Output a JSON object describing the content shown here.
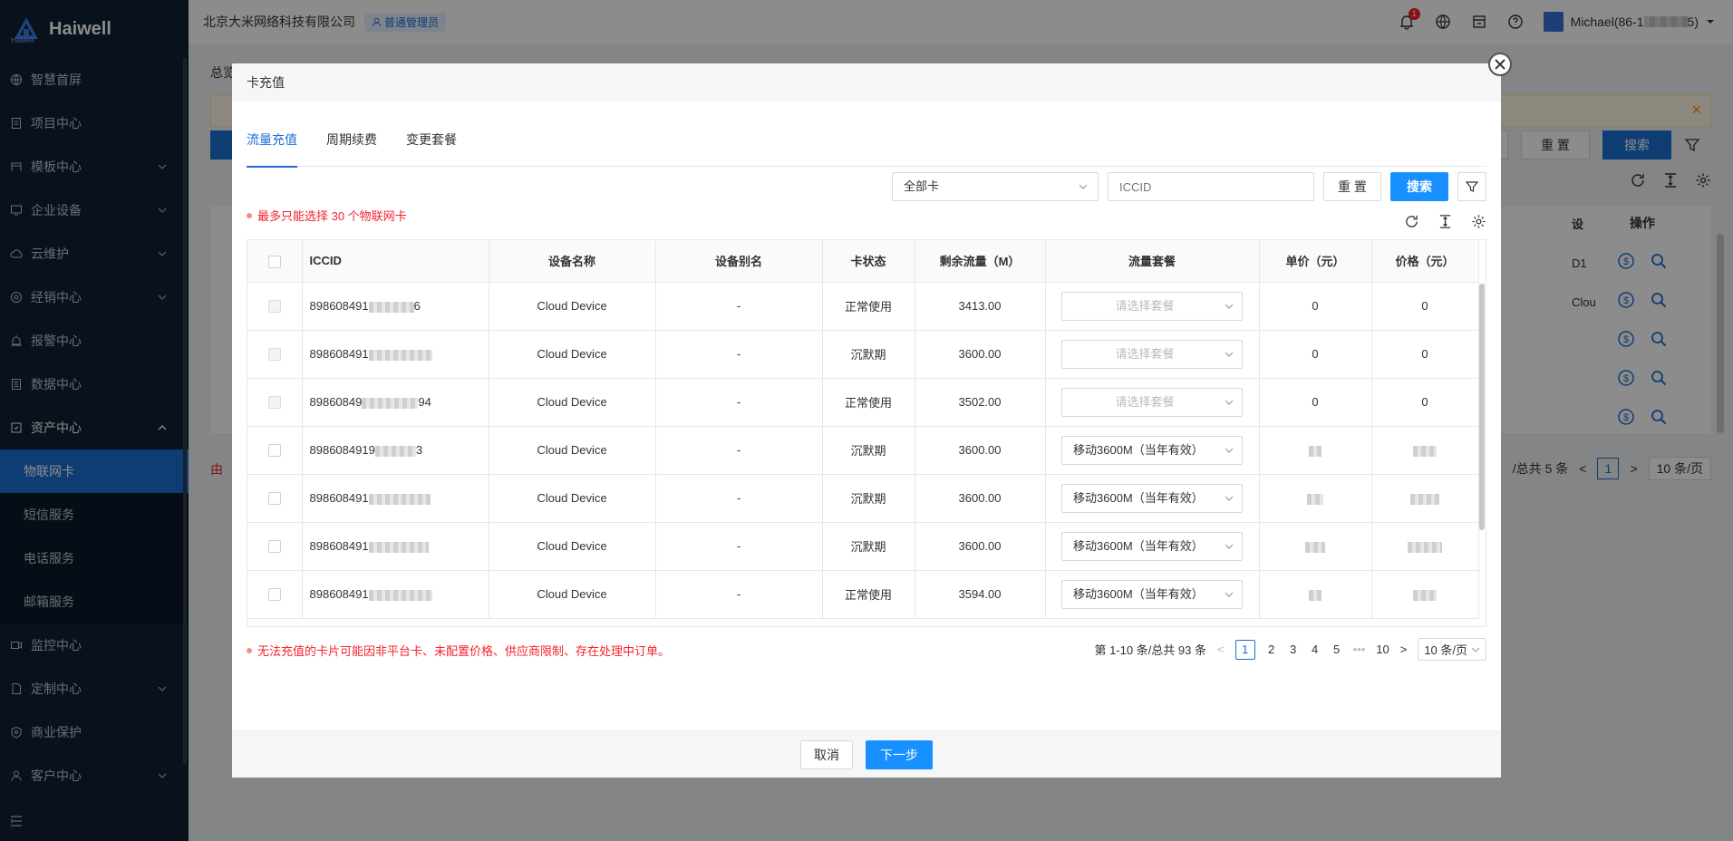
{
  "brand": {
    "name": "Haiwell",
    "sub": "Haiwell"
  },
  "header": {
    "company": "北京大米网络科技有限公司",
    "role": "普通管理员",
    "notif_count": "1",
    "user_name_prefix": "Michael(86-1",
    "user_name_suffix": "5)"
  },
  "sidebar": {
    "items": [
      {
        "label": "智慧首屏",
        "icon": "globe-icon"
      },
      {
        "label": "项目中心",
        "icon": "doc-icon"
      },
      {
        "label": "模板中心",
        "icon": "template-icon"
      },
      {
        "label": "企业设备",
        "icon": "monitor-icon"
      },
      {
        "label": "云维护",
        "icon": "cloud-icon"
      },
      {
        "label": "经销中心",
        "icon": "dealer-icon"
      },
      {
        "label": "报警中心",
        "icon": "alarm-icon"
      },
      {
        "label": "数据中心",
        "icon": "data-icon"
      },
      {
        "label": "资产中心",
        "icon": "asset-icon"
      }
    ],
    "sub_items": [
      "物联网卡",
      "短信服务",
      "电话服务",
      "邮箱服务"
    ],
    "items_after": [
      {
        "label": "监控中心",
        "icon": "camera-icon"
      },
      {
        "label": "定制中心",
        "icon": "custom-icon"
      },
      {
        "label": "商业保护",
        "icon": "shield-icon"
      },
      {
        "label": "客户中心",
        "icon": "user-icon"
      }
    ]
  },
  "background": {
    "crumb": "总览",
    "reset": "重 置",
    "search": "搜索",
    "ops_header": "操作",
    "col_header": "设",
    "col_values": [
      "D1",
      "Clou"
    ],
    "pager_total": "/总共 5 条",
    "pager_current": "1",
    "pager_size": "10 条/页",
    "red_text": "由"
  },
  "modal": {
    "title": "卡充值",
    "tabs": [
      "流量充值",
      "周期续费",
      "变更套餐"
    ],
    "filter": {
      "select_value": "全部卡",
      "iccid_placeholder": "ICCID",
      "reset": "重 置",
      "search": "搜索"
    },
    "limit_note": "最多只能选择 30 个物联网卡",
    "columns": [
      "ICCID",
      "设备名称",
      "设备别名",
      "卡状态",
      "剩余流量（M）",
      "流量套餐",
      "单价（元）",
      "价格（元）"
    ],
    "rows": [
      {
        "iccid_prefix": "898608491",
        "iccid_suffix": "6",
        "device": "Cloud Device",
        "alias": "-",
        "status": "正常使用",
        "remaining": "3413.00",
        "package": "请选择套餐",
        "package_placeholder": true,
        "unit": "0",
        "price": "0",
        "disabled": true
      },
      {
        "iccid_prefix": "898608491",
        "iccid_suffix": "",
        "device": "Cloud Device",
        "alias": "-",
        "status": "沉默期",
        "remaining": "3600.00",
        "package": "请选择套餐",
        "package_placeholder": true,
        "unit": "0",
        "price": "0",
        "disabled": true
      },
      {
        "iccid_prefix": "89860849",
        "iccid_suffix": "94",
        "device": "Cloud Device",
        "alias": "-",
        "status": "正常使用",
        "remaining": "3502.00",
        "package": "请选择套餐",
        "package_placeholder": true,
        "unit": "0",
        "price": "0",
        "disabled": true
      },
      {
        "iccid_prefix": "8986084919",
        "iccid_suffix": "3",
        "device": "Cloud Device",
        "alias": "-",
        "status": "沉默期",
        "remaining": "3600.00",
        "package": "移动3600M（当年有效）",
        "package_placeholder": false,
        "unit": "",
        "price": "",
        "disabled": false
      },
      {
        "iccid_prefix": "898608491",
        "iccid_suffix": "",
        "device": "Cloud Device",
        "alias": "-",
        "status": "沉默期",
        "remaining": "3600.00",
        "package": "移动3600M（当年有效）",
        "package_placeholder": false,
        "unit": "",
        "price": "",
        "disabled": false
      },
      {
        "iccid_prefix": "898608491",
        "iccid_suffix": "",
        "device": "Cloud Device",
        "alias": "-",
        "status": "沉默期",
        "remaining": "3600.00",
        "package": "移动3600M（当年有效）",
        "package_placeholder": false,
        "unit": "",
        "price": "",
        "disabled": false
      },
      {
        "iccid_prefix": "898608491",
        "iccid_suffix": "",
        "device": "Cloud Device",
        "alias": "-",
        "status": "正常使用",
        "remaining": "3594.00",
        "package": "移动3600M（当年有效）",
        "package_placeholder": false,
        "unit": "",
        "price": "",
        "disabled": false
      }
    ],
    "warn_note": "无法充值的卡片可能因非平台卡、未配置价格、供应商限制、存在处理中订单。",
    "pager": {
      "range": "第 1-10 条/总共 93 条",
      "pages": [
        "1",
        "2",
        "3",
        "4",
        "5"
      ],
      "ellipsis": "•••",
      "last": "10",
      "size": "10 条/页",
      "prev": "<",
      "next": ">"
    },
    "footer": {
      "cancel": "取消",
      "next": "下一步"
    }
  },
  "colors": {
    "primary": "#1890ff",
    "sidebar": "#0f1f33",
    "danger": "#f5222d"
  }
}
